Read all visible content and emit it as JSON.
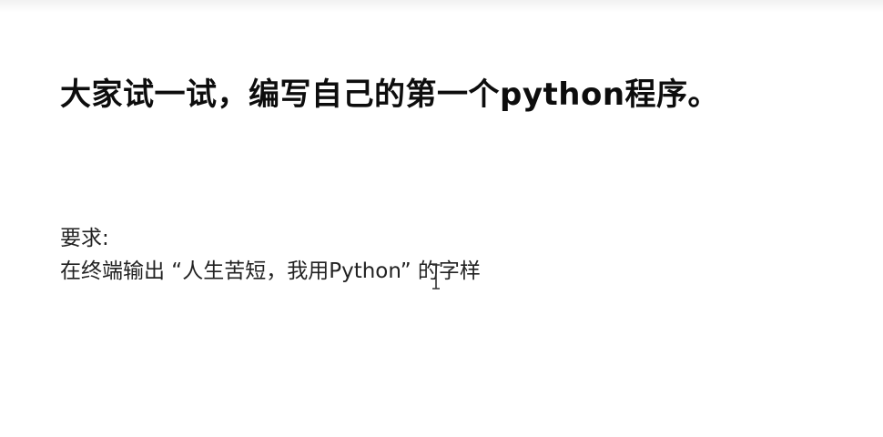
{
  "slide": {
    "title": "大家试一试，编写自己的第一个python程序。",
    "requirement_label": "要求:",
    "requirement_text": "在终端输出 “人生苦短，我用Python” 的字样"
  }
}
